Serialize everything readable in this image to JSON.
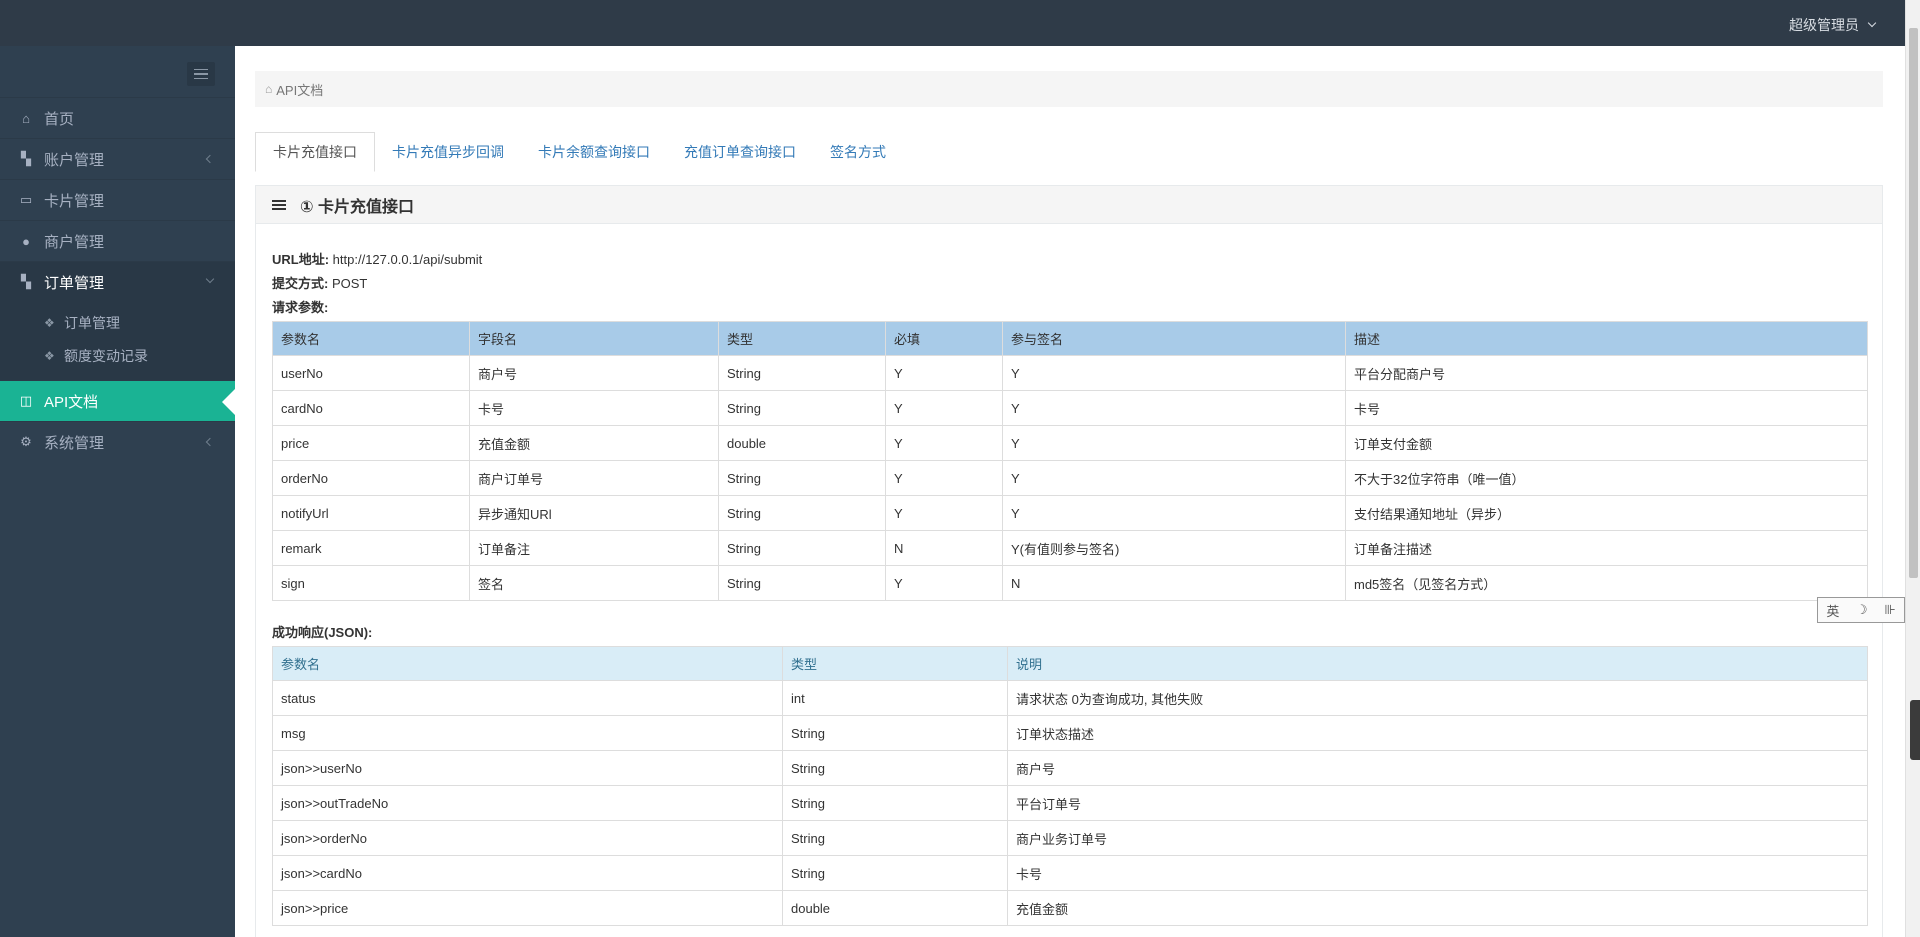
{
  "header": {
    "user_label": "超级管理员"
  },
  "sidebar": {
    "items": [
      {
        "label": "首页",
        "icon": "home-icon"
      },
      {
        "label": "账户管理",
        "icon": "cubes-icon"
      },
      {
        "label": "卡片管理",
        "icon": "card-icon"
      },
      {
        "label": "商户管理",
        "icon": "user-icon"
      },
      {
        "label": "订单管理",
        "icon": "cubes-icon"
      },
      {
        "label": "API文档",
        "icon": "columns-icon"
      },
      {
        "label": "系统管理",
        "icon": "gear-icon"
      }
    ],
    "sub_items": [
      {
        "label": "订单管理"
      },
      {
        "label": "额度变动记录"
      }
    ]
  },
  "breadcrumb": {
    "label": "API文档"
  },
  "tabs": [
    {
      "label": "卡片充值接口"
    },
    {
      "label": "卡片充值异步回调"
    },
    {
      "label": "卡片余额查询接口"
    },
    {
      "label": "充值订单查询接口"
    },
    {
      "label": "签名方式"
    }
  ],
  "panel": {
    "title": "① 卡片充值接口",
    "url_label": "URL地址:",
    "url_value": "http://127.0.0.1/api/submit",
    "method_label": "提交方式:",
    "method_value": "POST",
    "params_label": "请求参数:",
    "response_label": "成功响应(JSON):"
  },
  "request_table": {
    "headers": [
      "参数名",
      "字段名",
      "类型",
      "必填",
      "参与签名",
      "描述"
    ],
    "rows": [
      [
        "userNo",
        "商户号",
        "String",
        "Y",
        "Y",
        "平台分配商户号"
      ],
      [
        "cardNo",
        "卡号",
        "String",
        "Y",
        "Y",
        "卡号"
      ],
      [
        "price",
        "充值金额",
        "double",
        "Y",
        "Y",
        "订单支付金额"
      ],
      [
        "orderNo",
        "商户订单号",
        "String",
        "Y",
        "Y",
        "不大于32位字符串（唯一值）"
      ],
      [
        "notifyUrl",
        "异步通知URl",
        "String",
        "Y",
        "Y",
        "支付结果通知地址（异步）"
      ],
      [
        "remark",
        "订单备注",
        "String",
        "N",
        "Y(有值则参与签名)",
        "订单备注描述"
      ],
      [
        "sign",
        "签名",
        "String",
        "Y",
        "N",
        "md5签名（见签名方式）"
      ]
    ]
  },
  "response_table": {
    "headers": [
      "参数名",
      "类型",
      "说明"
    ],
    "rows": [
      [
        "status",
        "int",
        "请求状态 0为查询成功, 其他失败"
      ],
      [
        "msg",
        "String",
        "订单状态描述"
      ],
      [
        "json>>userNo",
        "String",
        "商户号"
      ],
      [
        "json>>outTradeNo",
        "String",
        "平台订单号"
      ],
      [
        "json>>orderNo",
        "String",
        "商户业务订单号"
      ],
      [
        "json>>cardNo",
        "String",
        "卡号"
      ],
      [
        "json>>price",
        "double",
        "充值金额"
      ]
    ]
  },
  "ime": {
    "label": "英",
    "moon": "☽",
    "grid": "⊪"
  }
}
